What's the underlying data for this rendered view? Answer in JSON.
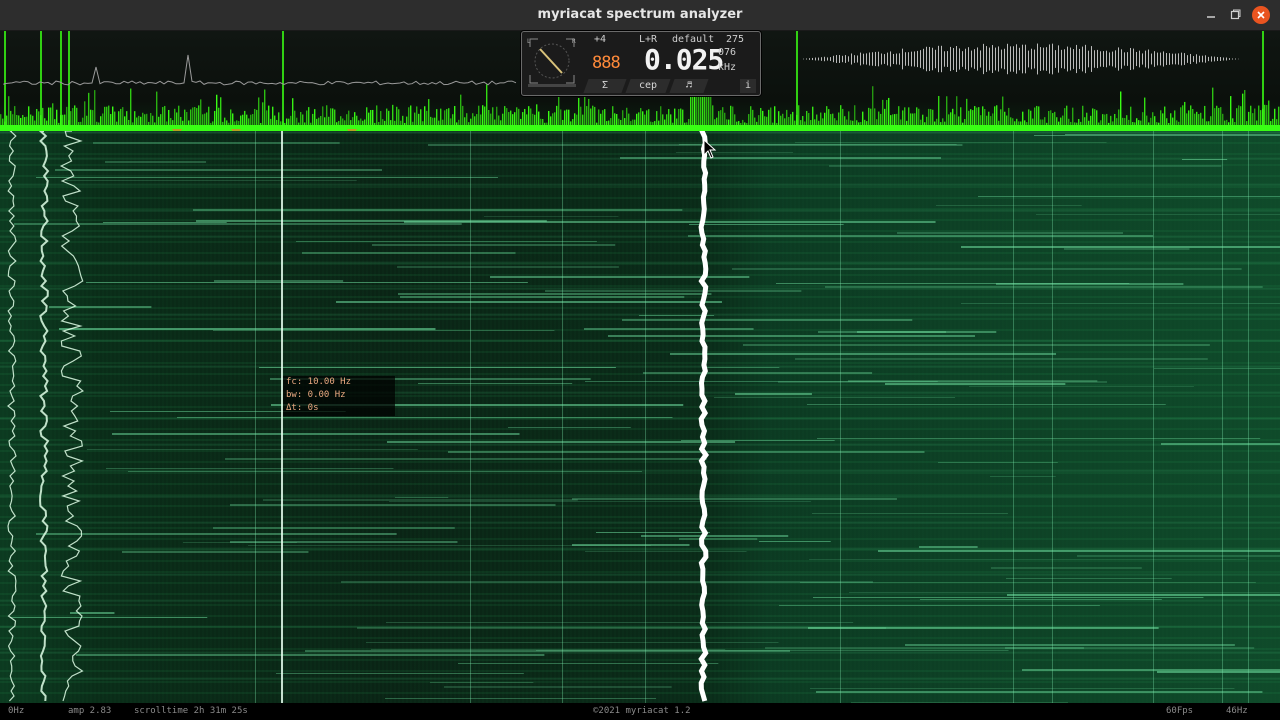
{
  "window": {
    "title": "myriacat spectrum analyzer"
  },
  "meter": {
    "dial_labels": {
      "left": "L",
      "right": "R"
    },
    "offset": "+4",
    "channel": "L+R",
    "profile": "default",
    "band_number": "275",
    "octave_display": "888",
    "frequency": "0.025",
    "cents": "076",
    "unit": "kHz",
    "tabs": [
      {
        "label": "Σ"
      },
      {
        "label": "cep"
      },
      {
        "label": "♬"
      },
      {
        "label": "i"
      }
    ]
  },
  "tooltip": {
    "fc": "fc: 10.00 Hz",
    "bw": "bw: 0.00 Hz",
    "dt": "Δt: 0s"
  },
  "status": {
    "min_freq": "0Hz",
    "amp": "amp 2.83",
    "scrolltime": "scrolltime 2h 31m 25s",
    "copyright": "©2021 myriacat 1.2",
    "fps": "60Fps",
    "max_freq": "46Hz"
  },
  "colors": {
    "spectrum_green": "#39ff14",
    "spectrogram_green": "#1f7a45",
    "titlebar": "#2d2d2d",
    "close_button": "#e95420",
    "octave_orange": "#ff8a3a"
  }
}
